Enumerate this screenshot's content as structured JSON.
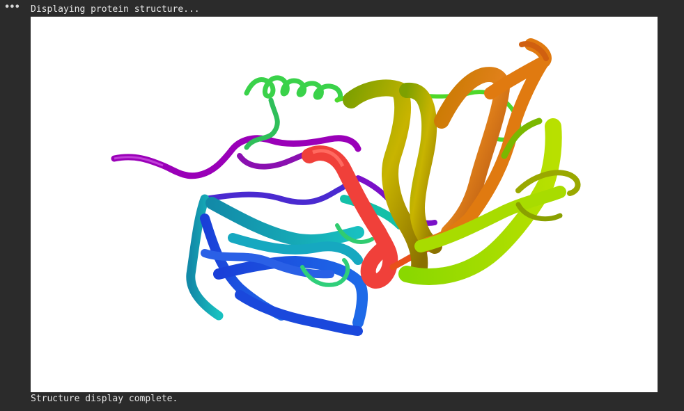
{
  "output": {
    "menu_icon": "more-horizontal-icon",
    "menu_glyph": "•••",
    "status_start": "Displaying protein structure...",
    "status_end": "Structure display complete."
  },
  "viewer": {
    "background": "#ffffff",
    "style": "cartoon",
    "color_scheme": "rainbow",
    "colors": [
      "#9a00b8",
      "#4a2ad0",
      "#1a5be0",
      "#12b3c8",
      "#2fcf7a",
      "#3ad24a",
      "#8fe010",
      "#d4c800",
      "#e08800",
      "#e8501a",
      "#f0403a"
    ]
  }
}
